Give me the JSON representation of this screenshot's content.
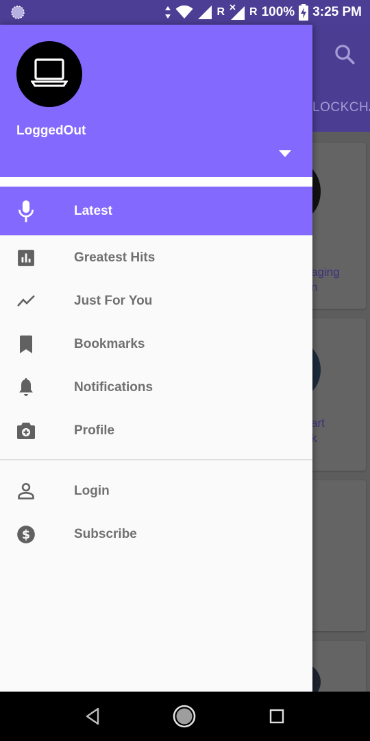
{
  "status_bar": {
    "battery_percent": "100%",
    "time": "3:25 PM",
    "roaming_1": "R",
    "roaming_2": "R",
    "icons": [
      "app-notification-icon",
      "data-arrows-icon",
      "wifi-icon",
      "signal-icon",
      "signal-no-data-icon",
      "battery-charging-icon"
    ]
  },
  "background_app": {
    "tab_label": "LOCKCHA",
    "card_texts": [
      "aging",
      "n",
      "art",
      "k"
    ]
  },
  "drawer": {
    "account": {
      "name": "LoggedOut",
      "avatar_icon": "laptop-icon"
    },
    "primary_items": [
      {
        "label": "Latest",
        "icon": "microphone-icon",
        "active": true
      },
      {
        "label": "Greatest Hits",
        "icon": "bar-chart-icon",
        "active": false
      },
      {
        "label": "Just For You",
        "icon": "trending-line-icon",
        "active": false
      },
      {
        "label": "Bookmarks",
        "icon": "bookmark-icon",
        "active": false
      },
      {
        "label": "Notifications",
        "icon": "bell-icon",
        "active": false
      },
      {
        "label": "Profile",
        "icon": "camera-plus-icon",
        "active": false
      }
    ],
    "secondary_items": [
      {
        "label": "Login",
        "icon": "person-outline-icon"
      },
      {
        "label": "Subscribe",
        "icon": "dollar-circle-icon"
      }
    ]
  },
  "colors": {
    "accent": "#8369fe",
    "toolbar_dimmed": "#4b3e94",
    "menu_text": "#707070",
    "icon_gray": "#616161"
  }
}
